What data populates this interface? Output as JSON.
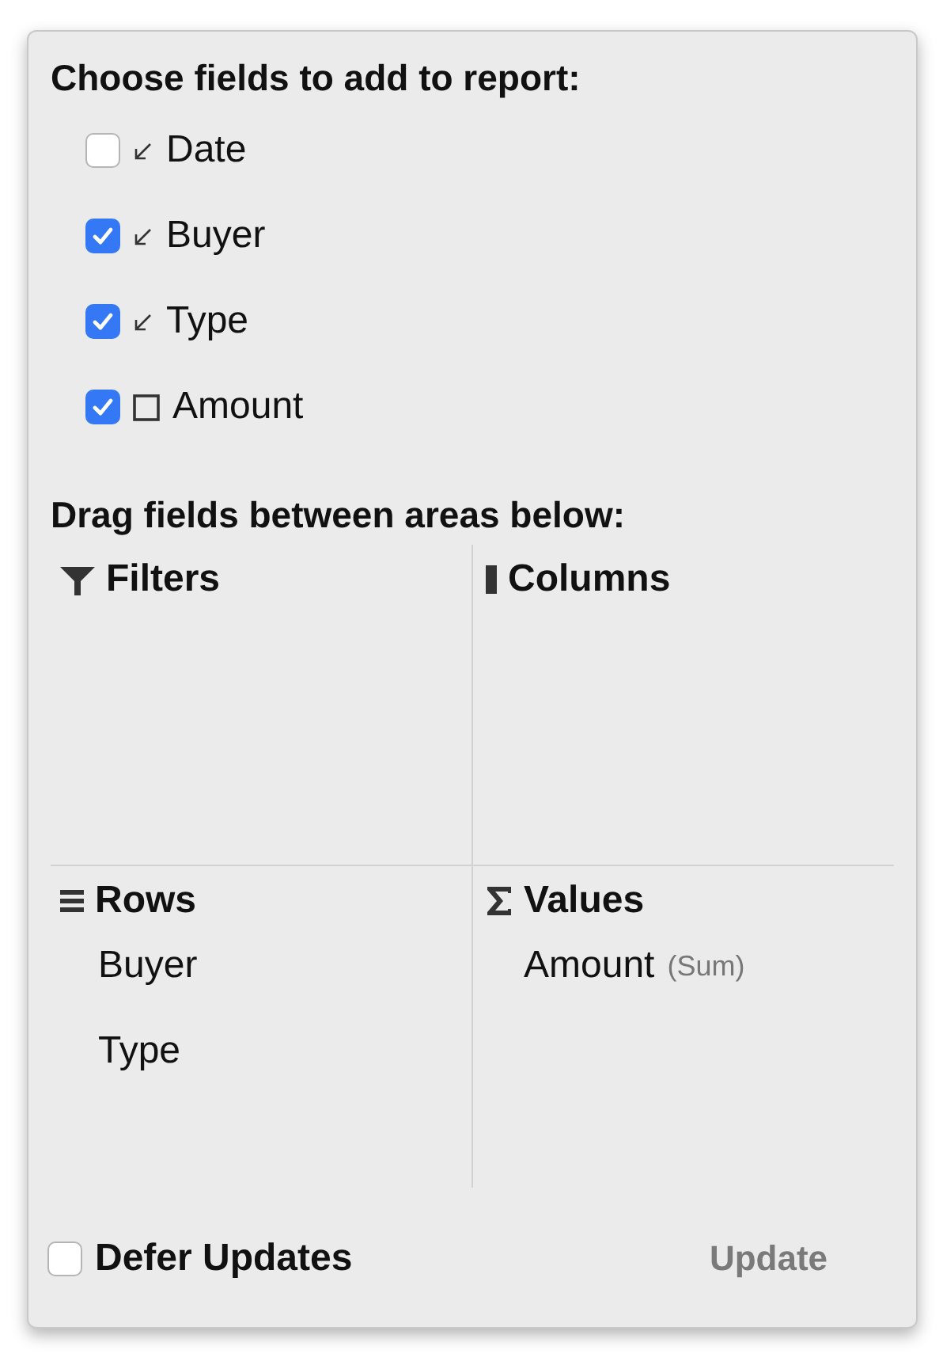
{
  "fields_section": {
    "title": "Choose fields to add to report:",
    "fields": [
      {
        "label": "Date",
        "kind": "dimension",
        "checked": false
      },
      {
        "label": "Buyer",
        "kind": "dimension",
        "checked": true
      },
      {
        "label": "Type",
        "kind": "dimension",
        "checked": true
      },
      {
        "label": "Amount",
        "kind": "measure",
        "checked": true
      }
    ]
  },
  "areas_section": {
    "title": "Drag fields between areas below:",
    "areas": [
      {
        "kind": "filters",
        "title": "Filters"
      },
      {
        "kind": "columns",
        "title": "Columns"
      },
      {
        "kind": "rows",
        "title": "Rows",
        "items": [
          {
            "label": "Buyer"
          },
          {
            "label": "Type"
          }
        ]
      },
      {
        "kind": "values",
        "title": "Values",
        "items": [
          {
            "label": "Amount",
            "summary": "(Sum)"
          }
        ]
      }
    ]
  },
  "footer": {
    "defer_updates": {
      "label": "Defer Updates",
      "checked": false
    },
    "update_button": {
      "label": "Update",
      "disabled": true
    }
  }
}
